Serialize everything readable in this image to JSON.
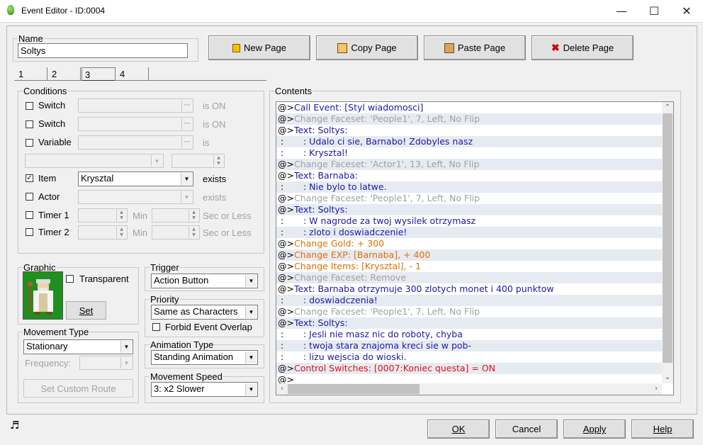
{
  "window": {
    "title": "Event Editor - ID:0004",
    "minimize_glyph": "—",
    "maximize_glyph": "☐",
    "close_glyph": "✕"
  },
  "name_section": {
    "label": "Name",
    "value": "Soltys"
  },
  "page_buttons": {
    "new": "New Page",
    "copy": "Copy Page",
    "paste": "Paste Page",
    "delete": "Delete Page"
  },
  "tabs": [
    {
      "label": "1"
    },
    {
      "label": "2"
    },
    {
      "label": "3"
    },
    {
      "label": "4"
    }
  ],
  "selected_tab": "3",
  "conditions": {
    "label": "Conditions",
    "switch1": {
      "label": "Switch",
      "value": "",
      "suffix": "is ON"
    },
    "switch2": {
      "label": "Switch",
      "value": "",
      "suffix": "is ON"
    },
    "variable": {
      "label": "Variable",
      "value": "",
      "suffix": "is"
    },
    "item": {
      "label": "Item",
      "value": "Krysztal",
      "suffix": "exists",
      "checked": true
    },
    "actor": {
      "label": "Actor",
      "value": "",
      "suffix": "exists"
    },
    "timer1": {
      "label": "Timer 1",
      "min_label": "Min",
      "sec_label": "Sec or Less"
    },
    "timer2": {
      "label": "Timer 2",
      "min_label": "Min",
      "sec_label": "Sec or Less"
    }
  },
  "graphic": {
    "label": "Graphic",
    "transparent_label": "Transparent",
    "set_label": "Set"
  },
  "trigger": {
    "label": "Trigger",
    "value": "Action Button"
  },
  "priority": {
    "label": "Priority",
    "value": "Same as Characters",
    "forbid_label": "Forbid Event Overlap"
  },
  "movement_type": {
    "label": "Movement Type",
    "value": "Stationary",
    "frequency_label": "Frequency:",
    "custom_route_label": "Set Custom Route"
  },
  "animation_type": {
    "label": "Animation Type",
    "value": "Standing Animation"
  },
  "movement_speed": {
    "label": "Movement Speed",
    "value": "3: x2 Slower"
  },
  "contents": {
    "label": "Contents",
    "lines": [
      {
        "prefix": "@>",
        "text": "Call Event: [Styl wiadomosci]",
        "color": "blue"
      },
      {
        "prefix": "@>",
        "text": "Change Faceset: 'People1', 7, Left, No Flip",
        "color": "gray"
      },
      {
        "prefix": "@>",
        "text": "Text: Soltys:",
        "color": "blue"
      },
      {
        "prefix": " :",
        "text": "       : Udalo ci sie, Barnabo! Zdobyles nasz",
        "color": "blue"
      },
      {
        "prefix": " :",
        "text": "       : Krysztal!",
        "color": "blue"
      },
      {
        "prefix": "@>",
        "text": "Change Faceset: 'Actor1', 13, Left, No Flip",
        "color": "gray"
      },
      {
        "prefix": "@>",
        "text": "Text: Barnaba:",
        "color": "blue"
      },
      {
        "prefix": " :",
        "text": "       : Nie bylo to latwe.",
        "color": "blue"
      },
      {
        "prefix": "@>",
        "text": "Change Faceset: 'People1', 7, Left, No Flip",
        "color": "gray"
      },
      {
        "prefix": "@>",
        "text": "Text: Soltys:",
        "color": "blue"
      },
      {
        "prefix": " :",
        "text": "       : W nagrode za twoj wysilek otrzymasz",
        "color": "blue"
      },
      {
        "prefix": " :",
        "text": "       : zloto i doswiadczenie!",
        "color": "blue"
      },
      {
        "prefix": "@>",
        "text": "Change Gold: + 300",
        "color": "orange"
      },
      {
        "prefix": "@>",
        "text": "Change EXP: [Barnaba], + 400",
        "color": "orange"
      },
      {
        "prefix": "@>",
        "text": "Change Items: [Krysztal], - 1",
        "color": "orange"
      },
      {
        "prefix": "@>",
        "text": "Change Faceset: Remove",
        "color": "gray"
      },
      {
        "prefix": "@>",
        "text": "Text: Barnaba otrzymuje 300 zlotych monet i 400 punktow",
        "color": "blue"
      },
      {
        "prefix": " :",
        "text": "       : doswiadczenia!",
        "color": "blue"
      },
      {
        "prefix": "@>",
        "text": "Change Faceset: 'People1', 7, Left, No Flip",
        "color": "gray"
      },
      {
        "prefix": "@>",
        "text": "Text: Soltys:",
        "color": "blue"
      },
      {
        "prefix": " :",
        "text": "       : Jesli nie masz nic do roboty, chyba",
        "color": "blue"
      },
      {
        "prefix": " :",
        "text": "       : twoja stara znajoma kreci sie w pob-",
        "color": "blue"
      },
      {
        "prefix": " :",
        "text": "       : lizu wejscia do wioski.",
        "color": "blue"
      },
      {
        "prefix": "@>",
        "text": "Control Switches: [0007:Koniec questa] = ON",
        "color": "red"
      },
      {
        "prefix": "@>",
        "text": "",
        "color": "black"
      }
    ]
  },
  "footer": {
    "ok": "OK",
    "cancel": "Cancel",
    "apply": "Apply",
    "help": "Help"
  },
  "colors": {
    "blue": "#1a1aa6",
    "gray": "#a0a0a0",
    "orange": "#e07000",
    "red": "#e01010",
    "black": "#000000"
  }
}
